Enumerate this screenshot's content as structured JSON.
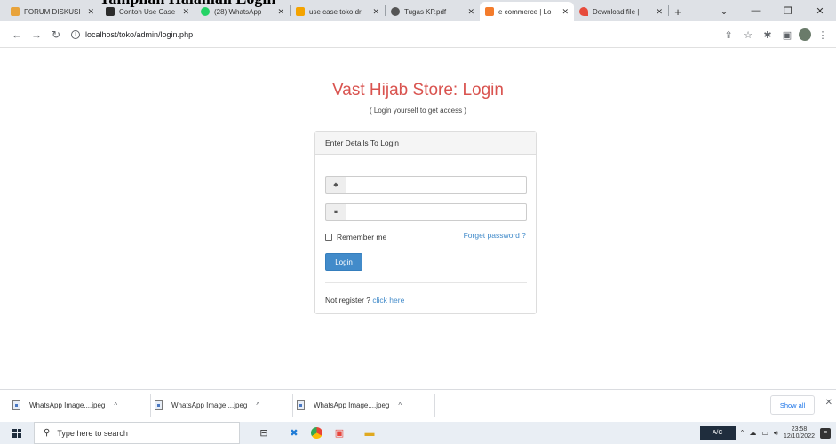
{
  "doc_heading": "Tampilan Halaman Login",
  "browser": {
    "tabs": [
      {
        "title": "FORUM DISKUSI",
        "favicon_color": "#e8a33b",
        "active": false
      },
      {
        "title": "Contoh Use Case",
        "favicon_color": "#2c2c2c",
        "active": false
      },
      {
        "title": "(28) WhatsApp",
        "favicon_color": "#25d366",
        "active": false
      },
      {
        "title": "use case toko.dr",
        "favicon_color": "#f4a300",
        "active": false
      },
      {
        "title": "Tugas KP.pdf",
        "favicon_color": "#555555",
        "active": false
      },
      {
        "title": "e commerce | Lo",
        "favicon_color": "#f47c2c",
        "active": true
      },
      {
        "title": "Download file | ",
        "favicon_color": "#e74c3c",
        "active": false
      }
    ],
    "address": "localhost/toko/admin/login.php"
  },
  "login": {
    "title": "Vast Hijab Store: Login",
    "subtitle": "( Login yourself to get access )",
    "panel_heading": "Enter Details To Login",
    "username_value": "",
    "password_value": "",
    "remember_label": "Remember me",
    "forgot_label": "Forget password ?",
    "login_button": "Login",
    "register_text": "Not register ? ",
    "register_link": "click here"
  },
  "downloads": {
    "items": [
      {
        "name": "WhatsApp Image....jpeg"
      },
      {
        "name": "WhatsApp Image....jpeg"
      },
      {
        "name": "WhatsApp Image....jpeg"
      }
    ],
    "show_all": "Show all"
  },
  "taskbar": {
    "search_placeholder": "Type here to search",
    "ac_label": "A/C",
    "time": "23:58",
    "date": "12/10/2022"
  },
  "colors": {
    "title_red": "#d9534f",
    "link_blue": "#428bca",
    "button_blue": "#428bca"
  }
}
